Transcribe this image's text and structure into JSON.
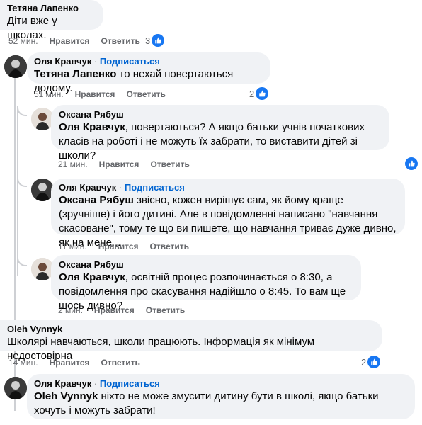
{
  "comments": [
    {
      "author": "Тетяна Лапенко",
      "text": "Діти вже у школах.",
      "time": "52 мин.",
      "reactions": "3"
    },
    {
      "author": "Оля Кравчук",
      "subscribe": "Подписаться",
      "mention": "Тетяна Лапенко",
      "text": " то нехай повертаються додому.",
      "time": "51 мин.",
      "reactions": "2"
    },
    {
      "author": "Оксана Рябуш",
      "mention": "Оля Кравчук",
      "text": ", повертаються? А якщо батьки учнів початкових класів на роботі і не можуть їх забрати, то виставити дітей зі школи?",
      "time": "21 мин.",
      "reactions": ""
    },
    {
      "author": "Оля Кравчук",
      "subscribe": "Подписаться",
      "mention": "Оксана Рябуш",
      "text": " звісно, кожен вирішує сам, як йому краще (зручніше) і його дитині. Але в повідомленні написано \"навчання скасоване\", тому те що ви пишете, що навчання триває дуже дивно, як на мене...",
      "time": "11 мин."
    },
    {
      "author": "Оксана Рябуш",
      "mention": "Оля Кравчук",
      "text": ", освітній процес розпочинається о 8:30, а повідомлення про скасування надійшло о 8:45. То вам ще щось дивно?",
      "time": "2 мин."
    },
    {
      "author": "Oleh Vynnyk",
      "text": "Школярі навчаються, школи працюють. Інформація як мінімум недостовірна",
      "time": "14 мин.",
      "reactions": "2"
    },
    {
      "author": "Оля Кравчук",
      "subscribe": "Подписаться",
      "mention": "Oleh Vynnyk",
      "text": " ніхто не може змусити дитину бути в школі, якщо батьки хочуть і можуть забрати!"
    }
  ],
  "actions": {
    "like": "Нравится",
    "reply": "Ответить"
  },
  "colors": {
    "bubble": "#f0f2f5",
    "link": "#0064d1",
    "like": "#1877f2",
    "meta": "#65676b"
  }
}
